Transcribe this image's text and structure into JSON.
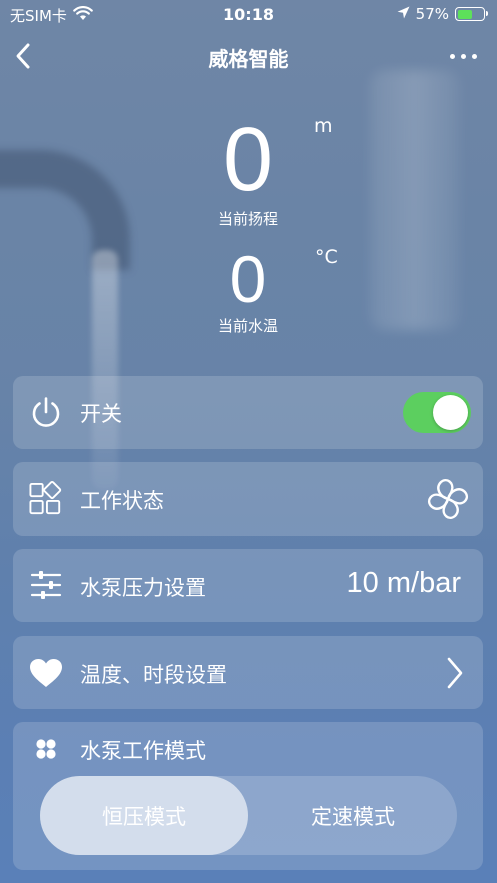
{
  "status_bar": {
    "carrier": "无SIM卡",
    "time": "10:18",
    "battery_percent": "57%",
    "battery_level": 0.57,
    "battery_color": "#5de05a"
  },
  "nav": {
    "title": "威格智能"
  },
  "readings": {
    "head": {
      "value": "0",
      "unit": "m",
      "label": "当前扬程"
    },
    "temperature": {
      "value": "0",
      "unit": "°C",
      "label": "当前水温"
    }
  },
  "controls": {
    "power": {
      "label": "开关",
      "on": true,
      "accent": "#5ccf5f"
    },
    "work_status": {
      "label": "工作状态"
    },
    "pressure": {
      "label": "水泵压力设置",
      "value": "10 m/bar"
    },
    "temp_time": {
      "label": "温度、时段设置"
    },
    "pump_mode": {
      "label": "水泵工作模式",
      "options": [
        "恒压模式",
        "定速模式"
      ],
      "selected": "恒压模式"
    }
  },
  "icons": {
    "back": "chevron-left-icon",
    "more": "more-dots-icon",
    "power": "power-icon",
    "work_status": "grid-shapes-icon",
    "fan": "fan-icon",
    "pressure": "sliders-icon",
    "temp_time": "heart-icon",
    "chevron": "chevron-right-icon",
    "mode": "clover-icon"
  }
}
